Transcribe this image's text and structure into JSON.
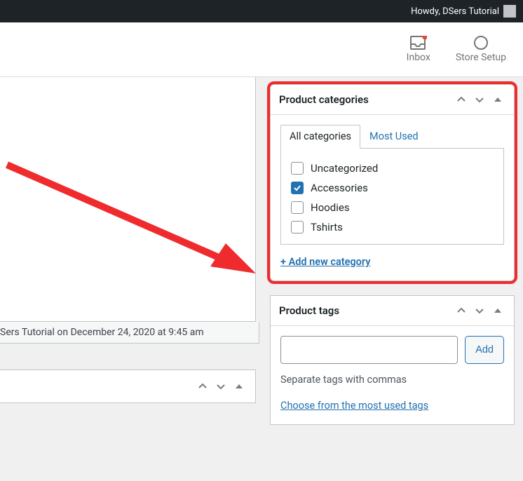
{
  "adminbar": {
    "howdy_text": "Howdy, DSers Tutorial"
  },
  "topnav": {
    "inbox_label": "Inbox",
    "store_setup_label": "Store Setup"
  },
  "last_edited_text": "Sers Tutorial on December 24, 2020 at 9:45 am",
  "categories_panel": {
    "title": "Product categories",
    "tabs": {
      "all": "All categories",
      "most_used": "Most Used"
    },
    "items": [
      {
        "label": "Uncategorized",
        "checked": false
      },
      {
        "label": "Accessories",
        "checked": true
      },
      {
        "label": "Hoodies",
        "checked": false
      },
      {
        "label": "Tshirts",
        "checked": false
      }
    ],
    "add_new_text": "+ Add new category"
  },
  "tags_panel": {
    "title": "Product tags",
    "add_button": "Add",
    "input_value": "",
    "hint": "Separate tags with commas",
    "choose_link": "Choose from the most used tags"
  },
  "colors": {
    "highlight": "#ef2b2d",
    "link": "#2271b1"
  }
}
